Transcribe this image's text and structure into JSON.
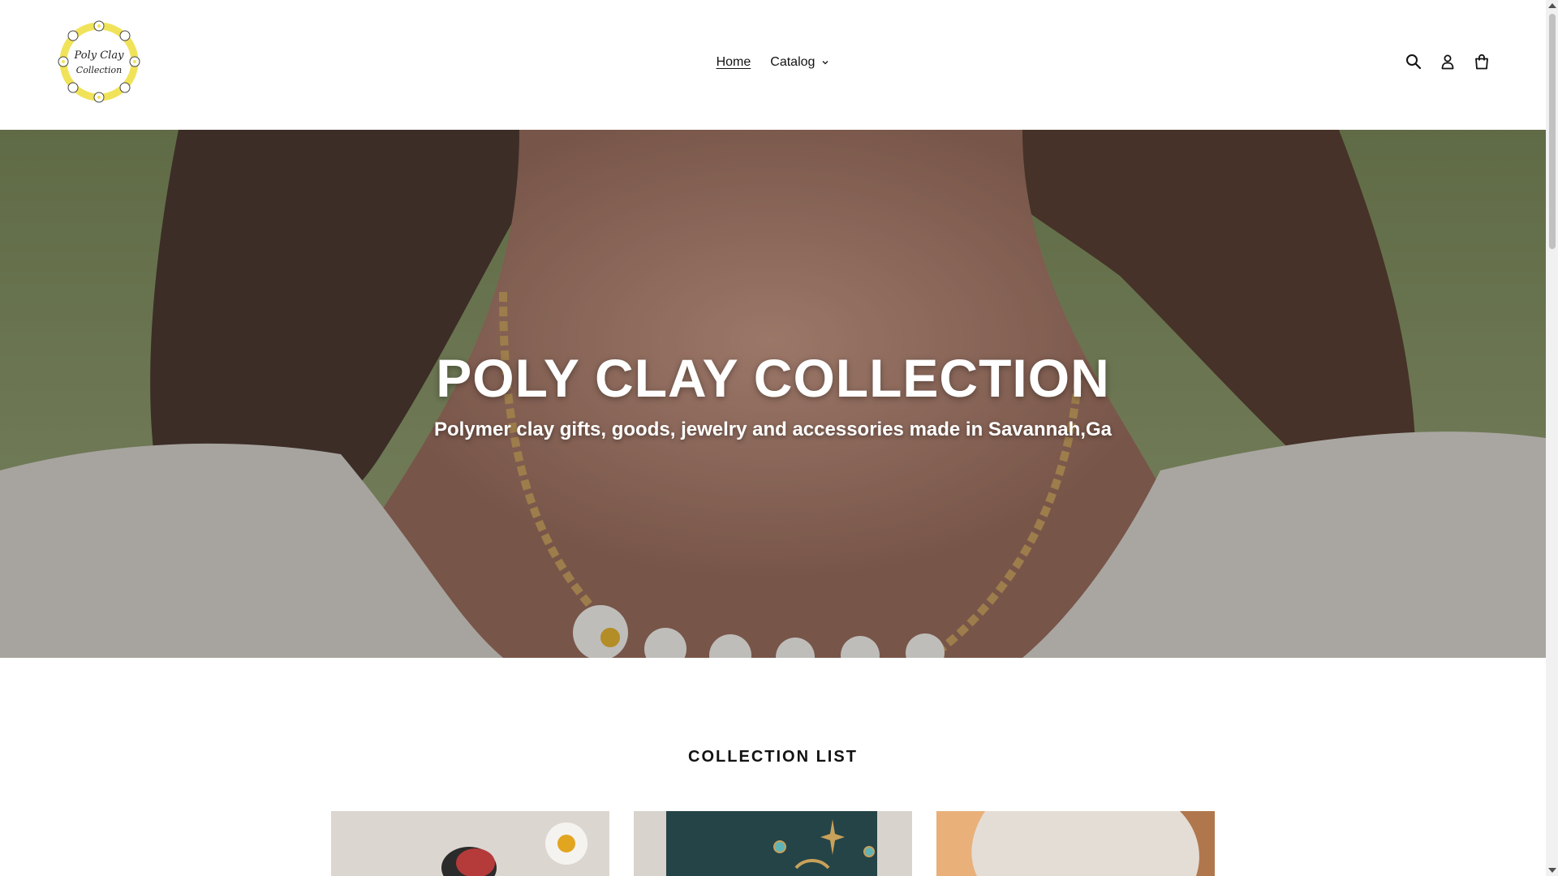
{
  "header": {
    "logo_text_line1": "Poly Clay",
    "logo_text_line2": "Collection",
    "nav": {
      "home_label": "Home",
      "catalog_label": "Catalog"
    },
    "icons": [
      "search-icon",
      "account-icon",
      "cart-icon"
    ]
  },
  "hero": {
    "title": "POLY CLAY COLLECTION",
    "subtitle": "Polymer clay gifts, goods, jewelry and accessories made in Savannah,Ga"
  },
  "collection_list": {
    "heading": "COLLECTION LIST"
  },
  "colors": {
    "text": "#121212",
    "logo_accent": "#f0e35a"
  }
}
